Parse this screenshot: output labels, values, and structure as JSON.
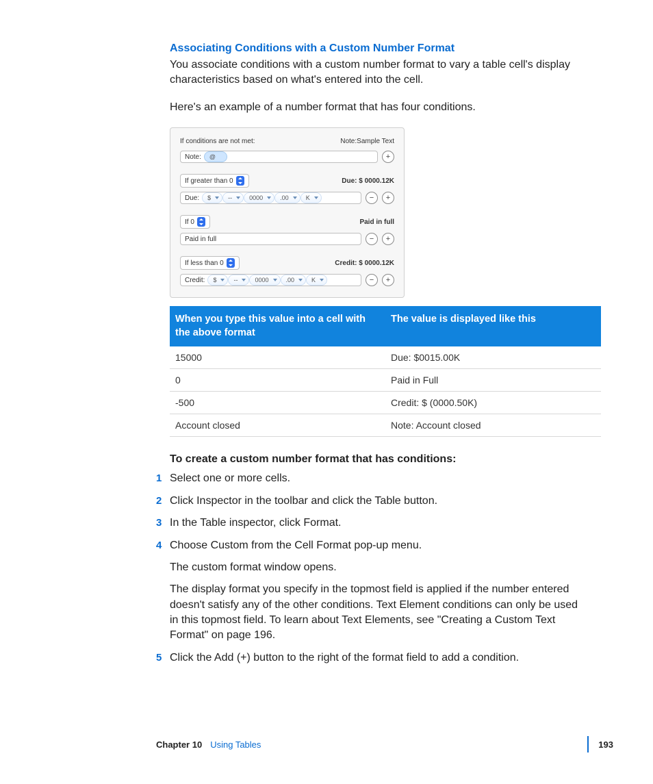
{
  "heading": "Associating Conditions with a Custom Number Format",
  "intro1": "You associate conditions with a custom number format to vary a table cell's display characteristics based on what's entered into the cell.",
  "intro2": "Here's an example of a number format that has four conditions.",
  "figure": {
    "top_left": "If conditions are not met:",
    "top_right": "Note:Sample Text",
    "note_prefix": "Note:",
    "at_token": "@",
    "cond1": {
      "select": "If greater than 0",
      "right": "Due: $   0000.12K",
      "prefix": "Due:",
      "tokens": [
        "$",
        "--",
        "0000",
        ".00",
        "K"
      ]
    },
    "cond2": {
      "select": "If 0",
      "right": "Paid in full",
      "field": "Paid in full"
    },
    "cond3": {
      "select": "If less than 0",
      "right": "Credit: $ 0000.12K",
      "prefix": "Credit:",
      "tokens": [
        "$",
        "--",
        "0000",
        ".00",
        "K"
      ]
    }
  },
  "table": {
    "head1": "When you type this value into a cell with the above format",
    "head2": "The value is displayed like this",
    "rows": [
      {
        "a": "15000",
        "b": "Due: $0015.00K"
      },
      {
        "a": "0",
        "b": "Paid in Full"
      },
      {
        "a": "-500",
        "b": "Credit: $ (0000.50K)"
      },
      {
        "a": "Account closed",
        "b": "Note: Account closed"
      }
    ]
  },
  "steps_title": "To create a custom number format that has conditions:",
  "steps": {
    "s1": "Select one or more cells.",
    "s2": "Click Inspector in the toolbar and click the Table button.",
    "s3": "In the Table inspector, click Format.",
    "s4": "Choose Custom from the Cell Format pop-up menu.",
    "s4p1": "The custom format window opens.",
    "s4p2": "The display format you specify in the topmost field is applied if the number entered doesn't satisfy any of the other conditions. Text Element conditions can only be used in this topmost field. To learn about Text Elements, see \"Creating a Custom Text Format\" on page 196.",
    "s5": "Click the Add (+) button to the right of the format field to add a condition."
  },
  "footer": {
    "chapter": "Chapter 10",
    "title": "Using Tables",
    "page": "193"
  }
}
